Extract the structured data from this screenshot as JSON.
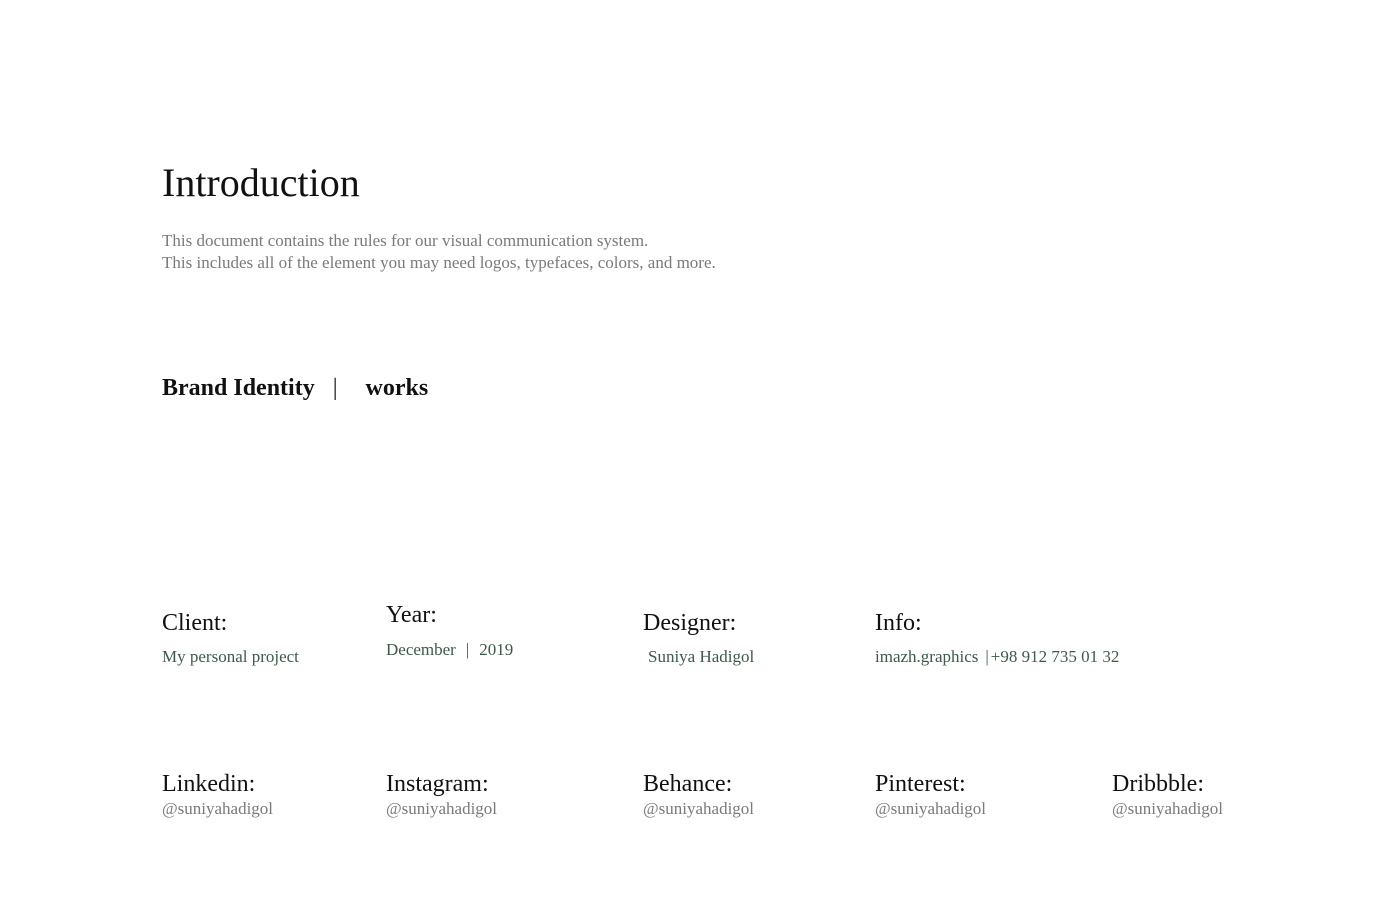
{
  "intro": {
    "title": "Introduction",
    "line1": "This document contains the rules for our visual communication system.",
    "line2": "This includes all of the element you may need logos, typefaces, colors, and more."
  },
  "brand": {
    "left": "Brand Identity",
    "separator": "|",
    "right": "works"
  },
  "details": {
    "client": {
      "label": "Client:",
      "value": "My personal project"
    },
    "year": {
      "label": "Year:",
      "month": "December",
      "separator": "|",
      "year": "2019"
    },
    "designer": {
      "label": "Designer:",
      "value": "Suniya Hadigol"
    },
    "info": {
      "label": "Info:",
      "website": "imazh.graphics",
      "separator": "|",
      "phone": "+98 912 735 01 32"
    }
  },
  "social": {
    "linkedin": {
      "label": "Linkedin:",
      "handle": "@suniyahadigol"
    },
    "instagram": {
      "label": "Instagram:",
      "handle": "@suniyahadigol"
    },
    "behance": {
      "label": "Behance:",
      "handle": "@suniyahadigol"
    },
    "pinterest": {
      "label": "Pinterest:",
      "handle": "@suniyahadigol"
    },
    "dribbble": {
      "label": "Dribbble:",
      "handle": "@suniyahadigol"
    }
  }
}
